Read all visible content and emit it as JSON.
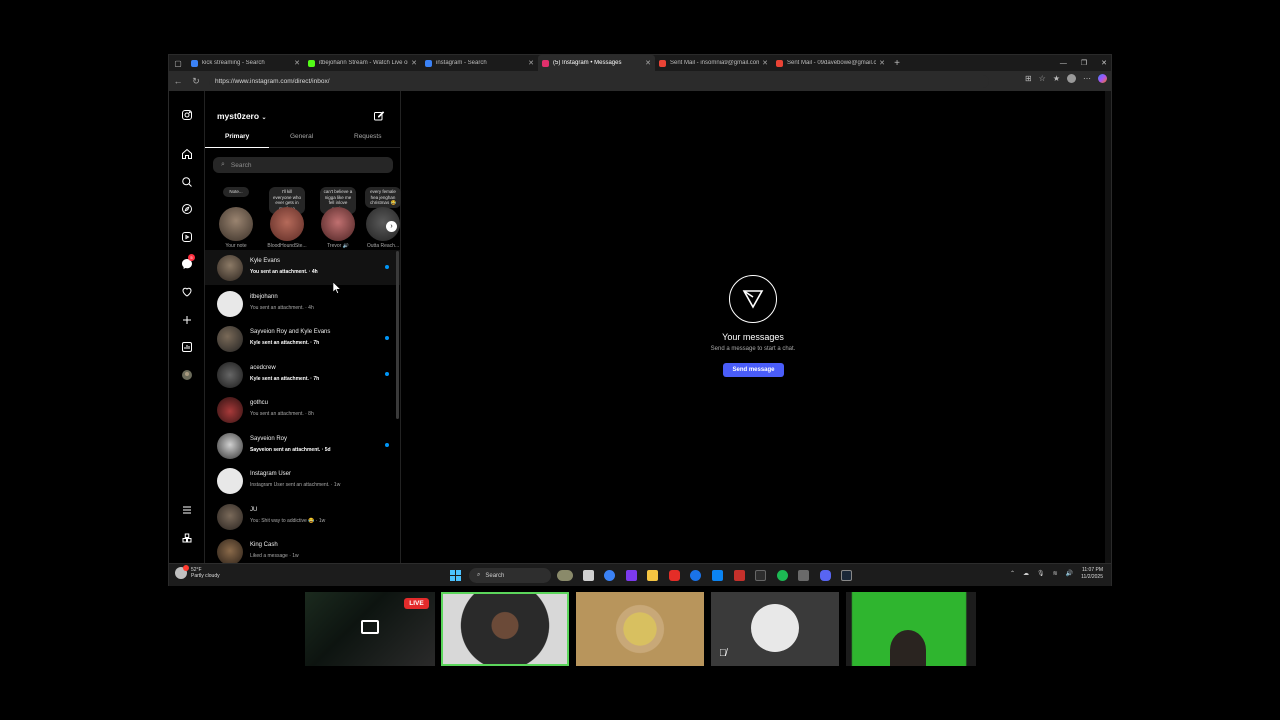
{
  "browser": {
    "tabs": [
      {
        "title": "kick streaming - Search",
        "favicon_color": "#3b82f6",
        "active": false
      },
      {
        "title": "itbejohann Stream - Watch Live on",
        "favicon_color": "#53fc18",
        "active": false
      },
      {
        "title": "instagram - Search",
        "favicon_color": "#3b82f6",
        "active": false
      },
      {
        "title": "(5) Instagram • Messages",
        "favicon_color": "#e1306c",
        "active": true
      },
      {
        "title": "Sent Mail - insomnia9@gmail.com",
        "favicon_color": "#ea4335",
        "active": false
      },
      {
        "title": "Sent Mail - 09davebowe@gmail.c",
        "favicon_color": "#ea4335",
        "active": false
      }
    ],
    "url": "https://www.instagram.com/direct/inbox/"
  },
  "inbox": {
    "username": "myst0zero",
    "tabs": [
      "Primary",
      "General",
      "Requests"
    ],
    "search_placeholder": "Search",
    "notes": [
      {
        "bubble": "Note...",
        "name": "Your note"
      },
      {
        "bubble": "I'll kill everyone who ever gets in my face",
        "name": "BloodHoundSte..."
      },
      {
        "bubble": "can't believe a nigga like me fell inlove agai...",
        "name": "Trevor 🔊"
      },
      {
        "bubble": "every female hea jenghan christmas 😂",
        "name": "Outta Reach..."
      }
    ],
    "conversations": [
      {
        "name": "Kyle Evans",
        "preview": "You sent an attachment. · 4h",
        "unread": true
      },
      {
        "name": "itbejohann",
        "preview": "You sent an attachment. · 4h",
        "unread": false
      },
      {
        "name": "Sayveion Roy and Kyle Evans",
        "preview": "Kyle sent an attachment. · 7h",
        "unread": true
      },
      {
        "name": "acedcrew",
        "preview": "Kyle sent an attachment. · 7h",
        "unread": true
      },
      {
        "name": "gothcu",
        "preview": "You sent an attachment. · 8h",
        "unread": false
      },
      {
        "name": "Sayveion Roy",
        "preview": "Sayveion sent an attachment. · 5d",
        "unread": true
      },
      {
        "name": "Instagram User",
        "preview": "Instagram User sent an attachment. · 1w",
        "unread": false
      },
      {
        "name": "JU",
        "preview": "You: Shit way to addictive 😂 · 1w",
        "unread": false
      },
      {
        "name": "King Cash",
        "preview": "Liked a message · 1w",
        "unread": false
      }
    ],
    "notification_count": "5"
  },
  "empty_state": {
    "title": "Your messages",
    "subtitle": "Send a message to start a chat.",
    "button": "Send message"
  },
  "taskbar": {
    "weather_temp": "52°F",
    "weather_desc": "Partly cloudy",
    "search_label": "Search",
    "time": "11:07 PM",
    "date": "11/2/2025"
  },
  "stream": {
    "live_label": "LIVE"
  },
  "colors": {
    "accent": "#4a5df9",
    "unread_dot": "#0095f6",
    "badge": "#ff3040",
    "live": "#e32b2b"
  }
}
